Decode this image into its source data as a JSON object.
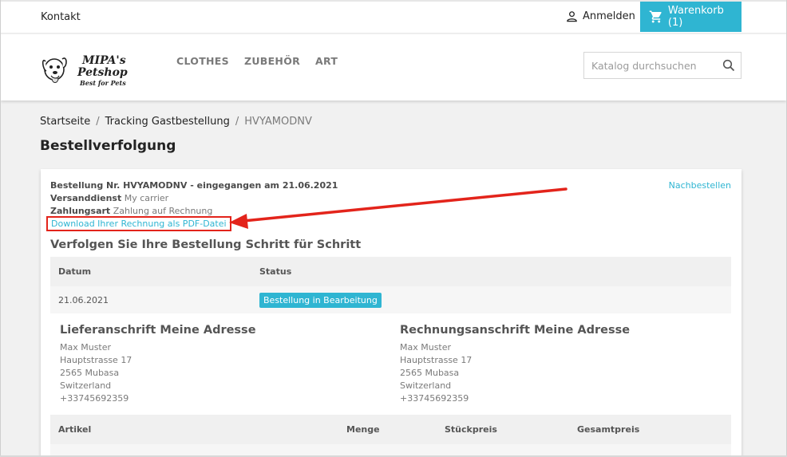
{
  "header": {
    "contact_label": "Kontakt",
    "signin_label": "Anmelden",
    "cart_label": "Warenkorb (1)",
    "menu": [
      "CLOTHES",
      "ZUBEHÖR",
      "ART"
    ],
    "search_placeholder": "Katalog durchsuchen",
    "logo": {
      "line1": "MIPA's",
      "line2": "Petshop",
      "line3": "Best for Pets"
    },
    "accent_color": "#2fb5d2"
  },
  "breadcrumb": [
    "Startseite",
    "Tracking Gastbestellung",
    "HVYAMODNV"
  ],
  "page_title": "Bestellverfolgung",
  "order": {
    "headline": "Bestellung Nr. HVYAMODNV - eingegangen am 21.06.2021",
    "carrier_label": "Versanddienst",
    "carrier_value": "My carrier",
    "payment_label": "Zahlungsart",
    "payment_value": "Zahlung auf Rechnung",
    "pdf_link": "Download Ihrer Rechnung als PDF-Datei",
    "reorder_link": "Nachbestellen"
  },
  "tracking": {
    "title": "Verfolgen Sie Ihre Bestellung Schritt für Schritt",
    "columns": [
      "Datum",
      "Status"
    ],
    "rows": [
      {
        "date": "21.06.2021",
        "status": "Bestellung in Bearbeitung",
        "status_color": "#2fb5d2"
      }
    ]
  },
  "delivery_address": {
    "title": "Lieferanschrift Meine Adresse",
    "lines": [
      "Max Muster",
      "Hauptstrasse 17",
      "2565 Mubasa",
      "Switzerland",
      "+33745692359"
    ]
  },
  "invoice_address": {
    "title": "Rechnungsanschrift Meine Adresse",
    "lines": [
      "Max Muster",
      "Hauptstrasse 17",
      "2565 Mubasa",
      "Switzerland",
      "+33745692359"
    ]
  },
  "items_table": {
    "columns": [
      "Artikel",
      "Menge",
      "Stückpreis",
      "Gesamtpreis"
    ]
  },
  "annotation": {
    "arrow_color": "#e3241b"
  }
}
